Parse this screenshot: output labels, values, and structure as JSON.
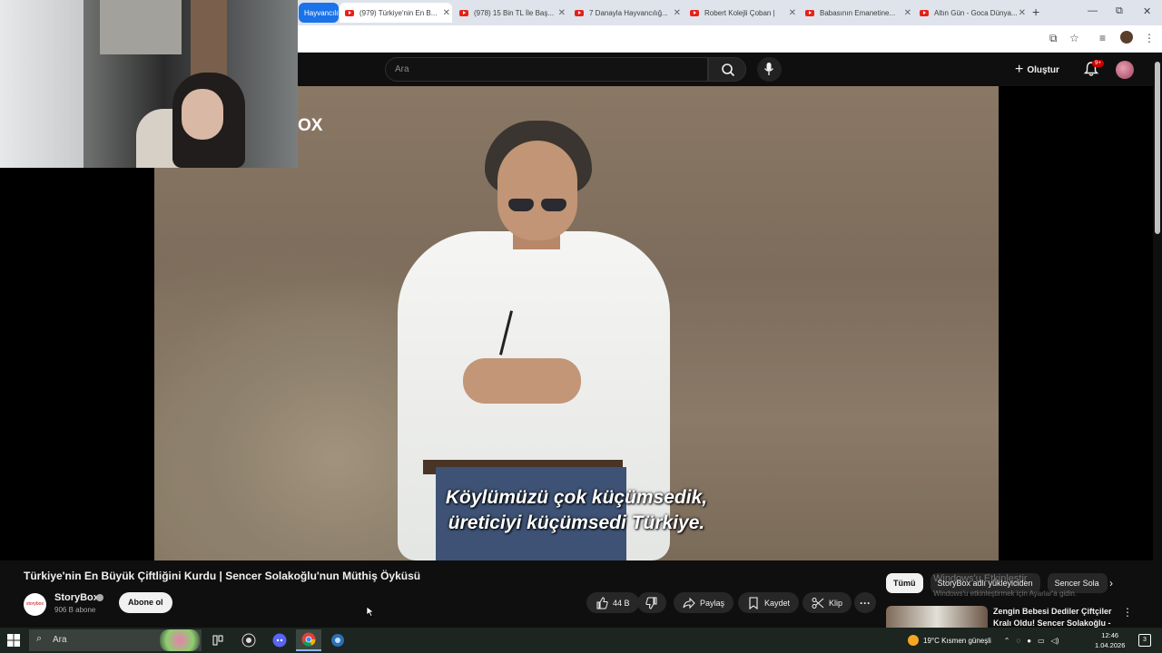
{
  "browser": {
    "tab_group_label": "Hayvancılık",
    "tabs": [
      {
        "title": "(979) Türkiye'nin En B...",
        "active": true
      },
      {
        "title": "(978) 15 Bin TL İle Baş..."
      },
      {
        "title": "7 Danayla Hayvancılığ..."
      },
      {
        "title": "Robert Kolejli Çoban |"
      },
      {
        "title": "Babasının Emanetine..."
      },
      {
        "title": "Altın Gün - Goca Dünya..."
      }
    ],
    "new_tab": "+",
    "window_controls": {
      "minimize": "—",
      "maximize": "⧉",
      "close": "✕"
    }
  },
  "youtube_header": {
    "search_placeholder": "Ara",
    "create_label": "Oluştur",
    "notifications_badge": "9+"
  },
  "player": {
    "brand_fragment": "OX",
    "subtitle_line1": "Köylümüzü çok küçümsedik,",
    "subtitle_line2": "üreticiyi küçümsedi Türkiye.",
    "watermark": "storybox"
  },
  "video": {
    "title": "Türkiye'nin En Büyük Çiftliğini Kurdu | Sencer Solakoğlu'nun Müthiş Öyküsü",
    "channel_logo_text": "storybox",
    "channel_name": "StoryBox",
    "subscribers": "906 B abone",
    "subscribe_label": "Abone ol",
    "likes": "44 B",
    "share_label": "Paylaş",
    "save_label": "Kaydet",
    "clip_label": "Klip"
  },
  "sidebar": {
    "chips": [
      "Tümü",
      "StoryBox adlı yükleyiciden",
      "Sencer Sola"
    ],
    "windows_activation_title": "Windows'u Etkinleştir",
    "windows_activation_text": "Windows'u etkinleştirmek için Ayarlar'a gidin.",
    "recommendation_title": "Zengin Bebesi Dediler Çiftçiler Kralı Oldu! Sencer Solakoğlu - ..."
  },
  "taskbar": {
    "search_placeholder": "Ara",
    "weather": "19°C  Kısmen güneşli",
    "time": "12:46",
    "date": "1.04.2026",
    "notification_count": "3"
  },
  "colors": {
    "yt_red": "#ff0000",
    "background": "#0f0f0f",
    "chip_selected": "#f1f1f1",
    "tab_group": "#1a73e8"
  }
}
